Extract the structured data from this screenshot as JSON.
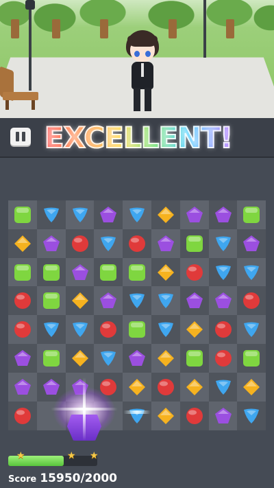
{
  "banner": {
    "text": "EXCELLENT!"
  },
  "score": {
    "label": "Score",
    "value": "15950/2000"
  },
  "progress": {
    "fraction": 0.62,
    "stars": 3
  },
  "colors": {
    "green": "#7fd640",
    "blue": "#3fa6ef",
    "red": "#e03a3a",
    "purple": "#9b4fe0",
    "yellow": "#f6b21f"
  },
  "board": {
    "cols": 9,
    "rows": 8,
    "grid": [
      [
        "green-square",
        "blue-triangle",
        "blue-triangle",
        "purple-pentagon",
        "blue-triangle",
        "yellow-diamond",
        "purple-pentagon",
        "purple-pentagon",
        "green-square"
      ],
      [
        "yellow-diamond",
        "purple-pentagon",
        "red-circle",
        "blue-triangle",
        "red-circle",
        "purple-pentagon",
        "green-square",
        "blue-triangle",
        "purple-pentagon"
      ],
      [
        "green-square",
        "green-square",
        "purple-pentagon",
        "green-square",
        "green-square",
        "yellow-diamond",
        "red-circle",
        "blue-triangle",
        "blue-triangle"
      ],
      [
        "red-circle",
        "green-square",
        "yellow-diamond",
        "purple-pentagon",
        "blue-triangle",
        "blue-triangle",
        "purple-pentagon",
        "purple-pentagon",
        "red-circle"
      ],
      [
        "red-circle",
        "blue-triangle",
        "blue-triangle",
        "red-circle",
        "green-square",
        "blue-triangle",
        "yellow-diamond",
        "red-circle",
        "blue-triangle"
      ],
      [
        "purple-pentagon",
        "green-square",
        "yellow-diamond",
        "blue-triangle",
        "purple-pentagon",
        "yellow-diamond",
        "green-square",
        "red-circle",
        "green-square"
      ],
      [
        "purple-pentagon",
        "purple-pentagon",
        "purple-pentagon",
        "red-circle",
        "yellow-diamond",
        "red-circle",
        "yellow-diamond",
        "blue-triangle",
        "yellow-diamond"
      ],
      [
        "red-circle",
        "empty",
        "empty",
        "empty",
        "blue-triangle",
        "yellow-diamond",
        "red-circle",
        "purple-pentagon",
        "blue-triangle"
      ]
    ]
  }
}
